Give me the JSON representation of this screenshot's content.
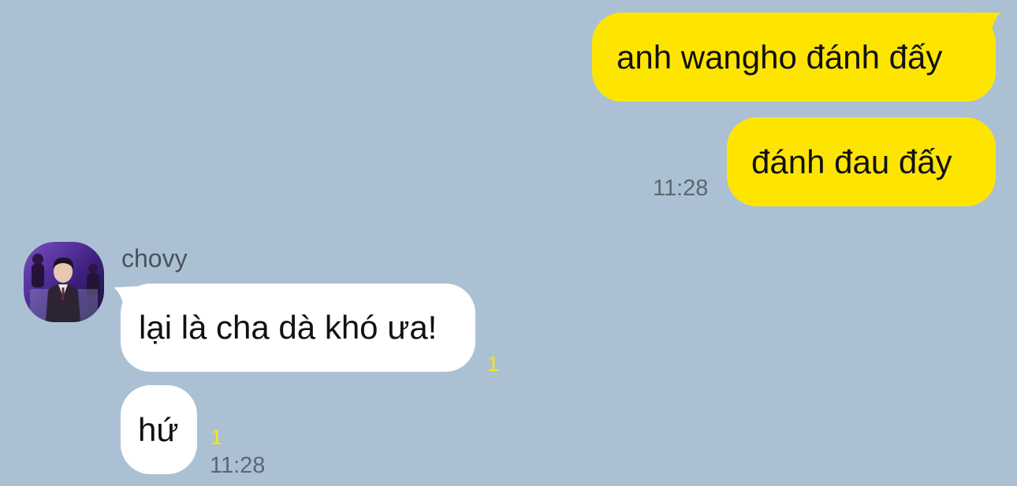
{
  "theme": {
    "background": "#abc1d3",
    "outgoing_bubble": "#fee500",
    "incoming_bubble": "#ffffff",
    "unread_color": "#fee500"
  },
  "messages_out": [
    {
      "text": "anh wangho đánh đấy"
    },
    {
      "text": "đánh đau đấy",
      "time": "11:28"
    }
  ],
  "contact": {
    "name": "chovy",
    "avatar_icon": "profile-photo"
  },
  "messages_in": [
    {
      "text": "lại là cha dà khó ưa!",
      "unread": "1"
    },
    {
      "text": "hứ",
      "unread": "1",
      "time": "11:28"
    }
  ]
}
